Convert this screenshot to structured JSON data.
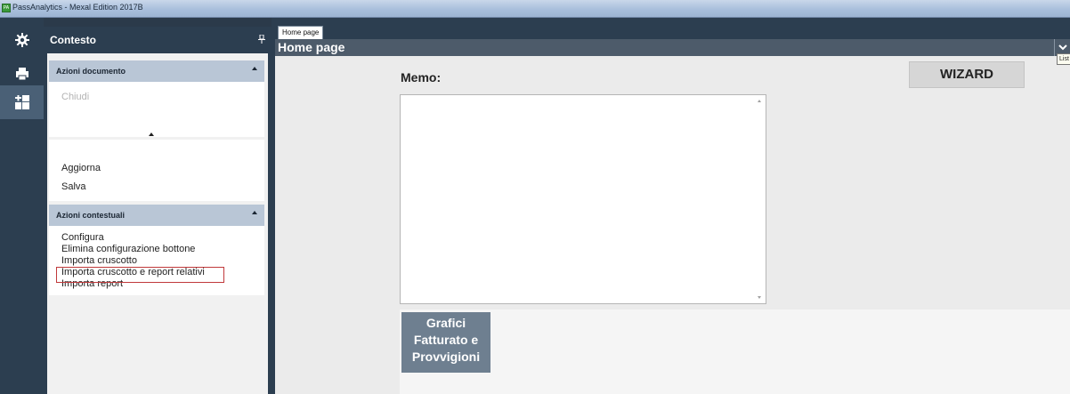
{
  "window": {
    "title": "PassAnalytics - Mexal Edition 2017B"
  },
  "rail": {
    "buttons": [
      "gear-icon",
      "printer-icon",
      "dashboard-add-icon"
    ],
    "active_index": 2
  },
  "context_panel": {
    "title": "Contesto",
    "sections": [
      {
        "title": "Azioni documento",
        "items": [
          "Chiudi",
          "Aggiorna",
          "Salva"
        ]
      },
      {
        "title": "Azioni contestuali",
        "items": [
          "Configura",
          "Elimina configurazione bottone",
          "Importa cruscotto",
          "Importa cruscotto e report relativi",
          "Importa report"
        ]
      }
    ]
  },
  "document": {
    "tab_label": "Home page",
    "page_title": "Home page",
    "tooltip": "List",
    "memo_label": "Memo:",
    "memo_value": "",
    "wizard_label": "WIZARD",
    "grafici_lines": [
      "Grafici",
      "Fatturato e",
      "Provvigioni"
    ]
  },
  "colors": {
    "rail_bg": "#2c3e50",
    "section_header": "#b9c6d6",
    "highlight_border": "#c0393b",
    "grafici_bg": "#6e7f90"
  }
}
